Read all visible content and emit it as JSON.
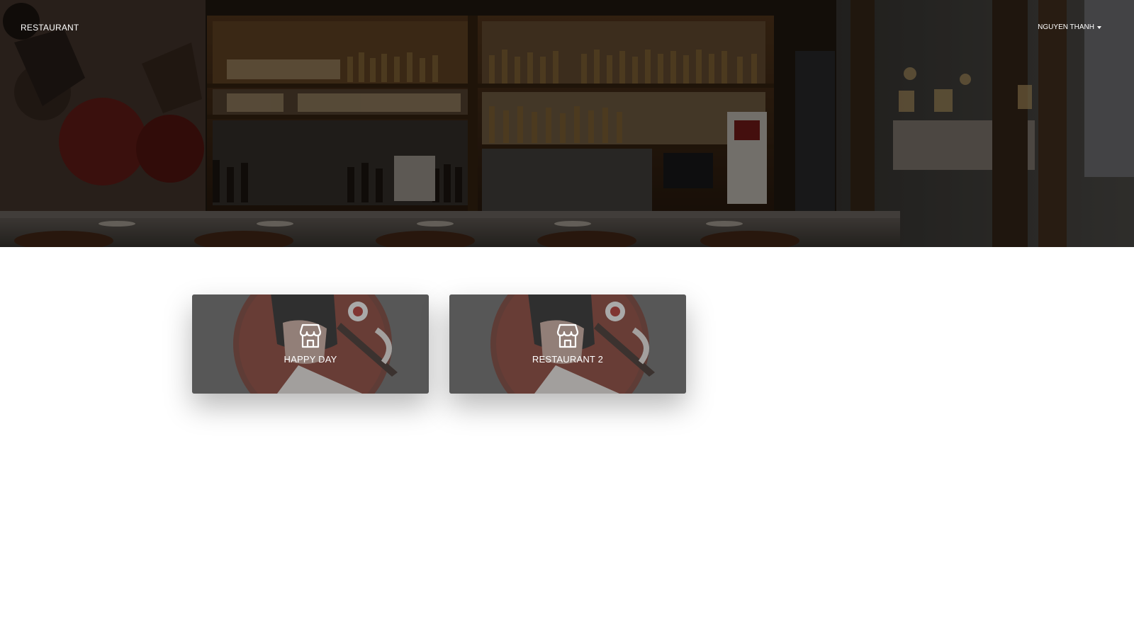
{
  "navbar": {
    "brand": "RESTAURANT",
    "user_name": "NGUYEN THANH",
    "user_dropdown_icon": "caret-down-icon"
  },
  "hero": {
    "image": "restaurant-bar-interior-photo"
  },
  "restaurants": [
    {
      "name": "HAPPY DAY",
      "icon": "store-icon"
    },
    {
      "name": "RESTAURANT 2",
      "icon": "store-icon"
    }
  ],
  "colors": {
    "card_background": "#5d5d5d",
    "text": "#ffffff"
  }
}
